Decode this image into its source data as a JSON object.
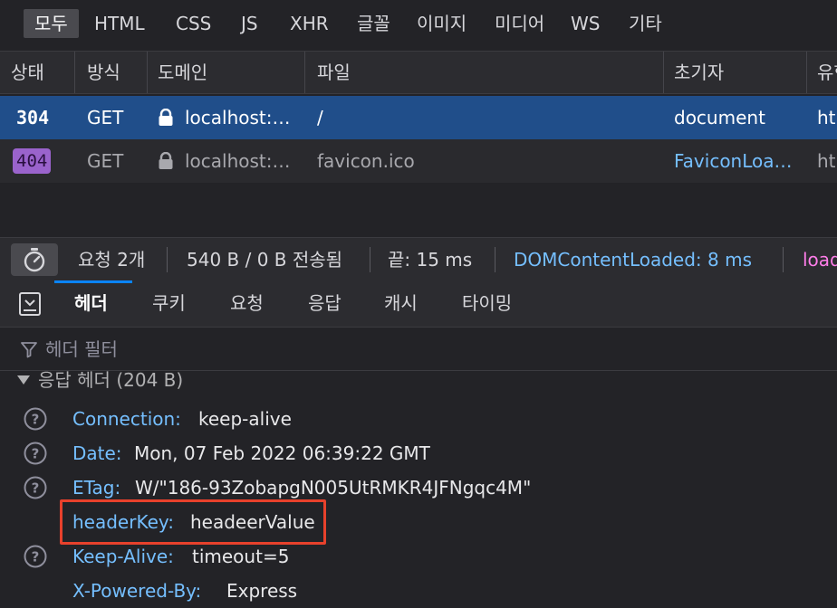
{
  "filter_tabs": [
    "모두",
    "HTML",
    "CSS",
    "JS",
    "XHR",
    "글꼴",
    "이미지",
    "미디어",
    "WS",
    "기타"
  ],
  "columns": [
    "상태",
    "방식",
    "도메인",
    "파일",
    "초기자",
    "유형"
  ],
  "requests": [
    {
      "status": "304",
      "method": "GET",
      "domain": "localhost:…",
      "file": "/",
      "initiator": "document",
      "type": "ht"
    },
    {
      "status": "404",
      "method": "GET",
      "domain": "localhost:…",
      "file": "favicon.ico",
      "initiator": "FaviconLoa…",
      "type": "ht"
    }
  ],
  "summary": {
    "requests": "요청 2개",
    "transferred": "540 B / 0 B 전송됨",
    "finish": "끝: 15 ms",
    "dom_content_loaded": "DOMContentLoaded: 8 ms",
    "load": "load"
  },
  "detail_tabs": [
    "헤더",
    "쿠키",
    "요청",
    "응답",
    "캐시",
    "타이밍"
  ],
  "header_filter_placeholder": "헤더 필터",
  "response_headers_title": "응답 헤더 (204 B)",
  "response_headers": [
    {
      "key": "Connection:",
      "value": "keep-alive",
      "help": true
    },
    {
      "key": "Date:",
      "value": "Mon, 07 Feb 2022 06:39:22 GMT",
      "help": true
    },
    {
      "key": "ETag:",
      "value": "W/\"186-93ZobapgN005UtRMKR4JFNgqc4M\"",
      "help": true
    },
    {
      "key": "headerKey:",
      "value": "headeerValue",
      "help": false
    },
    {
      "key": "Keep-Alive:",
      "value": "timeout=5",
      "help": true
    },
    {
      "key": "X-Powered-By:",
      "value": "Express",
      "help": false
    }
  ],
  "colors": {
    "selected_row": "#204e8a",
    "accent": "#0a84ff",
    "highlight": "#e8412c",
    "status_404": "#9a63cc"
  }
}
